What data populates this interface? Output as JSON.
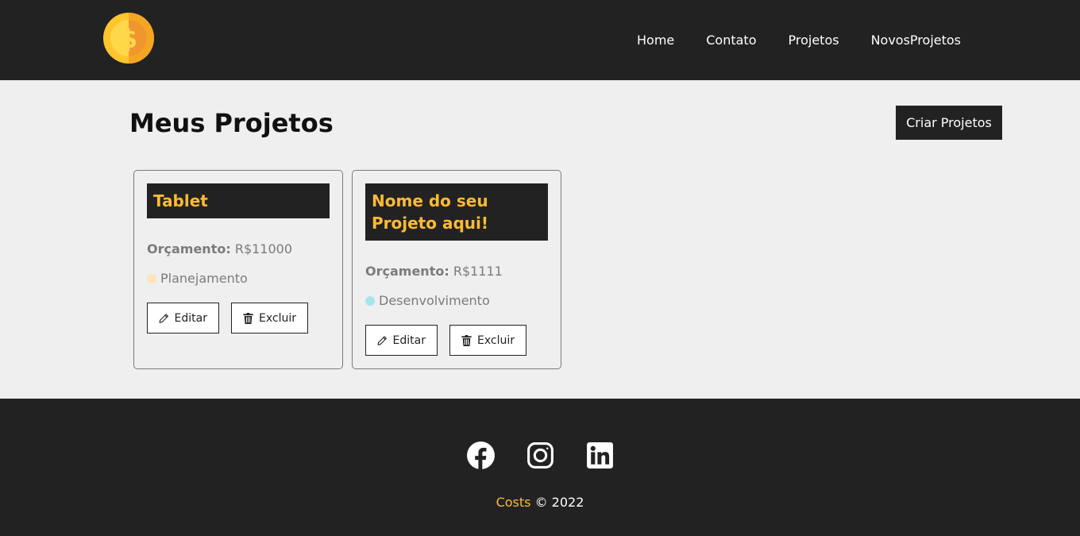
{
  "header": {
    "logo_alt": "Costs",
    "nav": [
      "Home",
      "Contato",
      "Projetos",
      "NovosProjetos"
    ]
  },
  "page": {
    "title": "Meus Projetos",
    "create_button": "Criar Projetos"
  },
  "projects": [
    {
      "name": "Tablet",
      "budget_label": "Orçamento:",
      "budget_value": "R$11000",
      "category": "Planejamento",
      "category_color": "#ffe4b5",
      "edit_label": "Editar",
      "delete_label": "Excluir"
    },
    {
      "name": "Nome do seu Projeto aqui!",
      "budget_label": "Orçamento:",
      "budget_value": "R$1111",
      "category": "Desenvolvimento",
      "category_color": "#a6e6e9",
      "edit_label": "Editar",
      "delete_label": "Excluir"
    }
  ],
  "footer": {
    "socials": [
      "facebook-icon",
      "instagram-icon",
      "linkedin-icon"
    ],
    "brand": "Costs",
    "copyright": "© 2022"
  },
  "colors": {
    "dark": "#222222",
    "accent": "#ffbb33",
    "background": "#efefef"
  }
}
